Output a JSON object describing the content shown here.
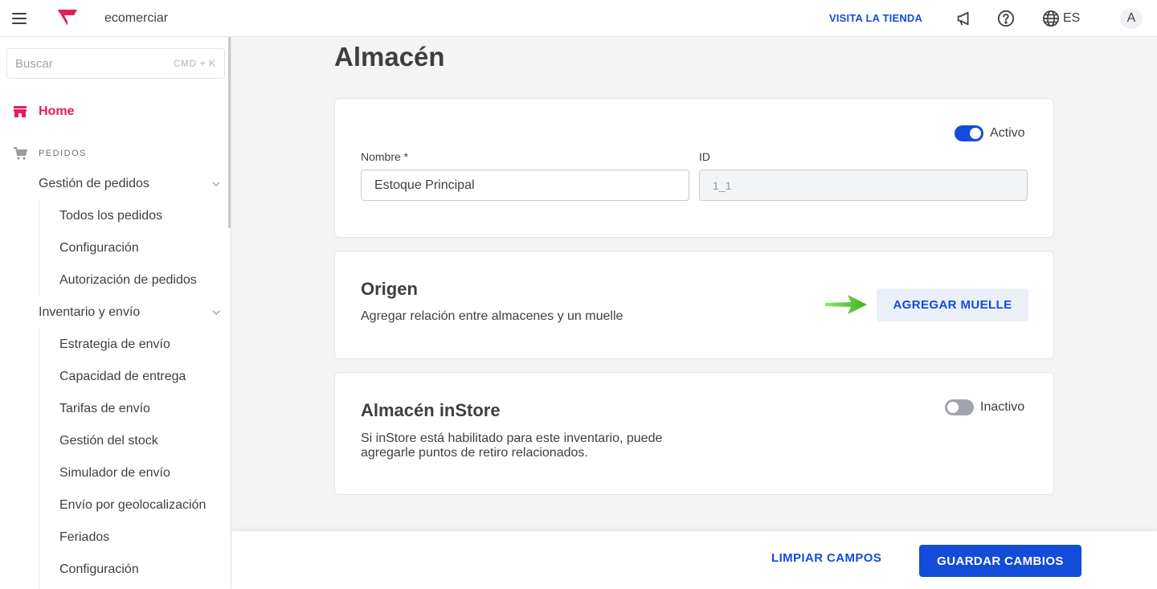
{
  "header": {
    "store_name": "ecomerciar",
    "visit_store": "VISITA LA TIENDA",
    "language": "ES",
    "avatar_initial": "A",
    "icons": [
      "menu-icon",
      "logo-icon",
      "megaphone-icon",
      "help-icon",
      "globe-icon"
    ]
  },
  "sidebar": {
    "search_placeholder": "Buscar",
    "search_shortcut": "CMD + K",
    "home_label": "Home",
    "section_label": "PEDIDOS",
    "groups": [
      {
        "label": "Gestión de pedidos",
        "items": [
          "Todos los pedidos",
          "Configuración",
          "Autorización de pedidos"
        ]
      },
      {
        "label": "Inventario y envío",
        "items": [
          "Estrategia de envío",
          "Capacidad de entrega",
          "Tarifas de envío",
          "Gestión del stock",
          "Simulador de envío",
          "Envío por geolocalización",
          "Feriados",
          "Configuración"
        ]
      }
    ]
  },
  "page": {
    "title": "Almacén",
    "general": {
      "active_label": "Activo",
      "active": true,
      "name_label": "Nombre *",
      "name_value": "Estoque Principal",
      "id_label": "ID",
      "id_value": "1_1"
    },
    "origin": {
      "title": "Origen",
      "description": "Agregar relación entre almacenes y un muelle",
      "button": "AGREGAR MUELLE"
    },
    "instore": {
      "title": "Almacén inStore",
      "description": "Si inStore está habilitado para este inventario, puede agregarle puntos de retiro relacionados.",
      "toggle_label": "Inactivo",
      "active": false
    }
  },
  "footer": {
    "clear_label": "LIMPIAR CAMPOS",
    "save_label": "GUARDAR CAMBIOS"
  },
  "colors": {
    "accent": "#134cd8",
    "brand": "#e31c58",
    "arrow": "#3db51c"
  }
}
